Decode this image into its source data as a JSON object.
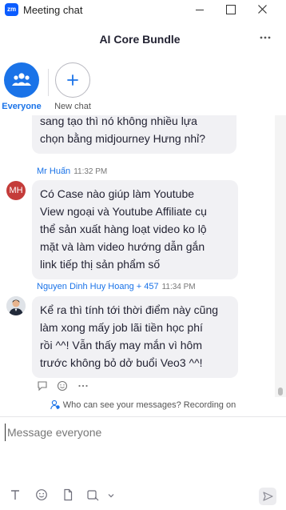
{
  "window": {
    "app_logo": "zm",
    "title": "Meeting chat"
  },
  "header": {
    "title": "AI Core Bundle"
  },
  "tabs": [
    {
      "label": "Everyone",
      "icon": "people-icon",
      "active": true
    },
    {
      "label": "New chat",
      "icon": "plus-icon",
      "active": false
    }
  ],
  "messages": [
    {
      "sender": "",
      "time": "",
      "text": "sang tạo thì nó không nhiều lựa\nchọn bằng midjourney Hưng nhỉ?"
    },
    {
      "sender": "Mr Huấn",
      "time": "11:32 PM",
      "avatar_initials": "MH",
      "text": "Có Case nào giúp làm Youtube\nView ngoại và Youtube Affiliate cụ\nthể sản xuất hàng loạt video ko lộ\nmặt và làm video hướng dẫn gắn\nlink tiếp thị sản phẩm số"
    },
    {
      "sender": "Nguyen Dinh Huy Hoang + 457",
      "time": "11:34 PM",
      "avatar": "user-photo",
      "text": "Kể ra thì tính tới thời điểm này cũng\nlàm xong mấy job lãi tiền học phí\nrồi ^^! Vẫn thấy may mắn vì hôm\ntrước không bỏ dở buổi Veo3 ^^!"
    }
  ],
  "privacy": {
    "text": "Who can see your messages? Recording on"
  },
  "compose": {
    "placeholder": "Message everyone"
  },
  "colors": {
    "accent": "#1a73e8",
    "bubble": "#f1f1f4",
    "mh_avatar": "#c43c3a"
  }
}
